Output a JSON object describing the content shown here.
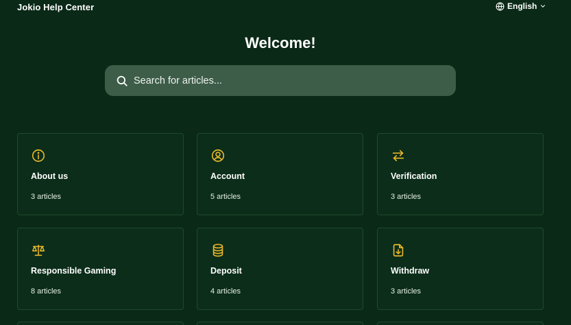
{
  "header": {
    "brand": "Jokio Help Center",
    "language": "English",
    "language_icon": "globe-icon",
    "dropdown_icon": "chevron-down-icon"
  },
  "hero": {
    "title": "Welcome!",
    "search_placeholder": "Search for articles...",
    "search_icon": "search-icon"
  },
  "theme": {
    "background": "#0a2917",
    "card_border": "#1f4a2e",
    "search_background": "#3d5d48",
    "icon_color": "#e8b72c"
  },
  "categories": [
    {
      "title": "About us",
      "count": "3 articles",
      "icon": "info-icon"
    },
    {
      "title": "Account",
      "count": "5 articles",
      "icon": "user-circle-icon"
    },
    {
      "title": "Verification",
      "count": "3 articles",
      "icon": "arrows-swap-icon"
    },
    {
      "title": "Responsible Gaming",
      "count": "8 articles",
      "icon": "scale-icon"
    },
    {
      "title": "Deposit",
      "count": "4 articles",
      "icon": "coins-stack-icon"
    },
    {
      "title": "Withdraw",
      "count": "3 articles",
      "icon": "file-download-icon"
    }
  ]
}
